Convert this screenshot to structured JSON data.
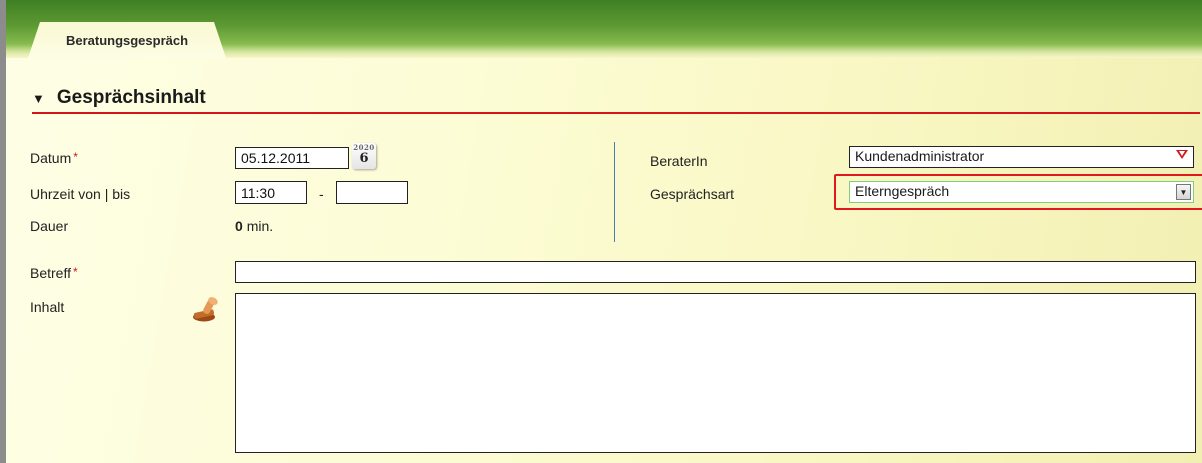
{
  "tab": {
    "label": "Beratungsgespräch"
  },
  "section": {
    "title": "Gesprächsinhalt"
  },
  "fields": {
    "datum": {
      "label": "Datum",
      "required": "*",
      "value": "05.12.2011"
    },
    "uhrzeit": {
      "label": "Uhrzeit von | bis",
      "from_value": "11:30",
      "separator": "-",
      "to_value": ""
    },
    "dauer": {
      "label": "Dauer",
      "value": "0",
      "unit": "min."
    },
    "beraterin": {
      "label": "BeraterIn",
      "value": "Kundenadministrator"
    },
    "gespraechsart": {
      "label": "Gesprächsart",
      "value": "Elterngespräch"
    },
    "betreff": {
      "label": "Betreff",
      "required": "*",
      "value": ""
    },
    "inhalt": {
      "label": "Inhalt",
      "value": ""
    }
  },
  "calendar_icon": {
    "year": "2020",
    "day": "6"
  },
  "icons": {
    "collapse": "triangle-down-icon",
    "calendar": "calendar-icon",
    "stamp": "stamp-icon",
    "dropdown": "dropdown-arrow-icon"
  },
  "colors": {
    "accent": "#d6151b",
    "divider": "#4a7fb5",
    "banner": "#5e9a33"
  }
}
